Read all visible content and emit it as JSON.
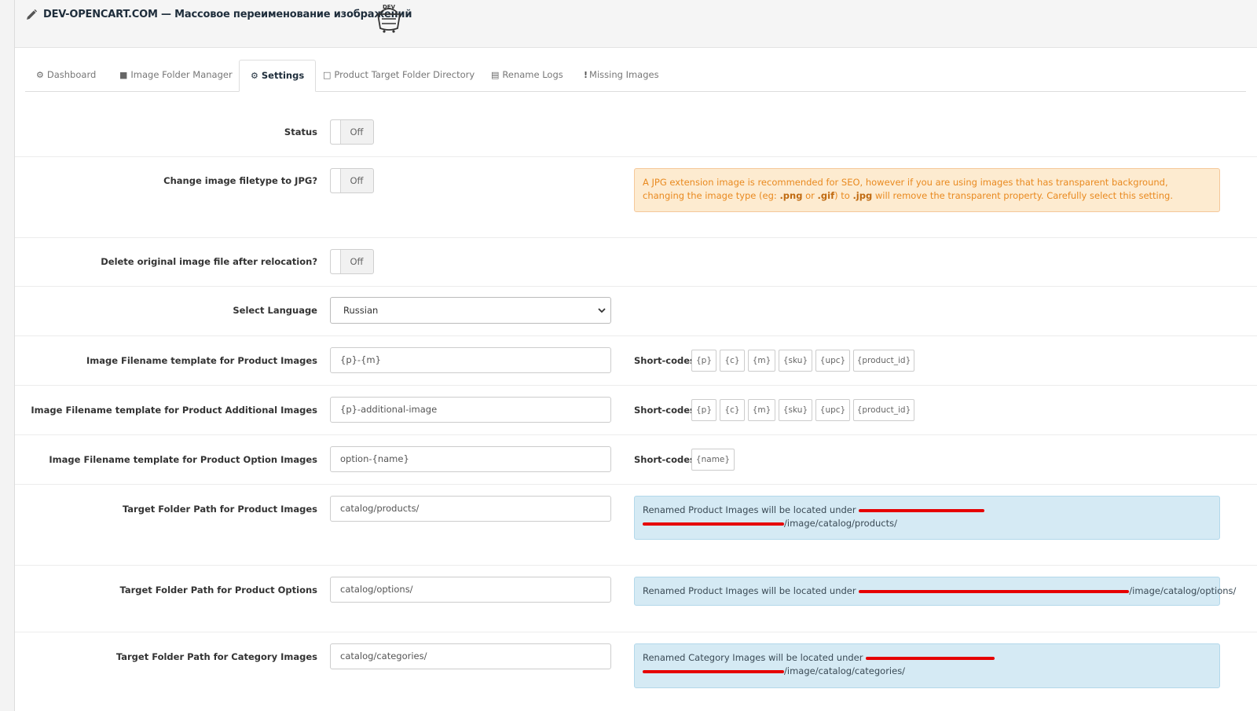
{
  "header": {
    "title": "DEV-OPENCART.COM — Массовое переименование изображений",
    "logo_text": "DEV"
  },
  "tabs": [
    {
      "label": "Dashboard",
      "icon": "dashboard-icon"
    },
    {
      "label": "Image Folder Manager",
      "icon": "folder-icon"
    },
    {
      "label": "Settings",
      "icon": "cogs-icon",
      "active": true
    },
    {
      "label": "Product Target Folder Directory",
      "icon": "folder-open-icon"
    },
    {
      "label": "Rename Logs",
      "icon": "calendar-icon"
    },
    {
      "label": "Missing Images",
      "icon": "exclamation-icon"
    }
  ],
  "settings": {
    "status": {
      "label": "Status",
      "value": "Off"
    },
    "change_filetype": {
      "label": "Change image filetype to JPG?",
      "value": "Off",
      "warning_before": "A JPG extension image is recommended for SEO, however if you are using images that has transparent background, changing the image type (eg: ",
      "png": ".png",
      "or": " or ",
      "gif": ".gif",
      "to": ") to ",
      "jpg": ".jpg",
      "warning_after": " will remove the transparent property. Carefully select this setting."
    },
    "delete_original": {
      "label": "Delete original image file after relocation?",
      "value": "Off"
    },
    "language": {
      "label": "Select Language",
      "value": "Russian"
    },
    "product_template": {
      "label": "Image Filename template for Product Images",
      "value": "{p}-{m}",
      "shortcodes_label": "Short-codes :",
      "codes": [
        "{p}",
        "{c}",
        "{m}",
        "{sku}",
        "{upc}",
        "{product_id}"
      ]
    },
    "additional_template": {
      "label": "Image Filename template for Product Additional Images",
      "value": "{p}-additional-image",
      "shortcodes_label": "Short-codes :",
      "codes": [
        "{p}",
        "{c}",
        "{m}",
        "{sku}",
        "{upc}",
        "{product_id}"
      ]
    },
    "option_template": {
      "label": "Image Filename template for Product Option Images",
      "value": "option-{name}",
      "shortcodes_label": "Short-codes :",
      "codes": [
        "{name}"
      ]
    },
    "product_folder": {
      "label": "Target Folder Path for Product Images",
      "value": "catalog/products/",
      "info_prefix": "Renamed Product Images will be located under ",
      "info_suffix": "/image/catalog/products/"
    },
    "options_folder": {
      "label": "Target Folder Path for Product Options",
      "value": "catalog/options/",
      "info_prefix": "Renamed Product Images will be located under ",
      "info_suffix": "/image/catalog/options/"
    },
    "category_folder": {
      "label": "Target Folder Path for Category Images",
      "value": "catalog/categories/",
      "info_prefix": "Renamed Category Images will be located under ",
      "info_suffix": "/image/catalog/categories/"
    }
  },
  "colors": {
    "accent_title": "#1e2d3b",
    "warning_bg": "#fdebd0",
    "warning_text": "#e98a20",
    "info_bg": "#d5eaf4",
    "redaction": "#e60000"
  }
}
